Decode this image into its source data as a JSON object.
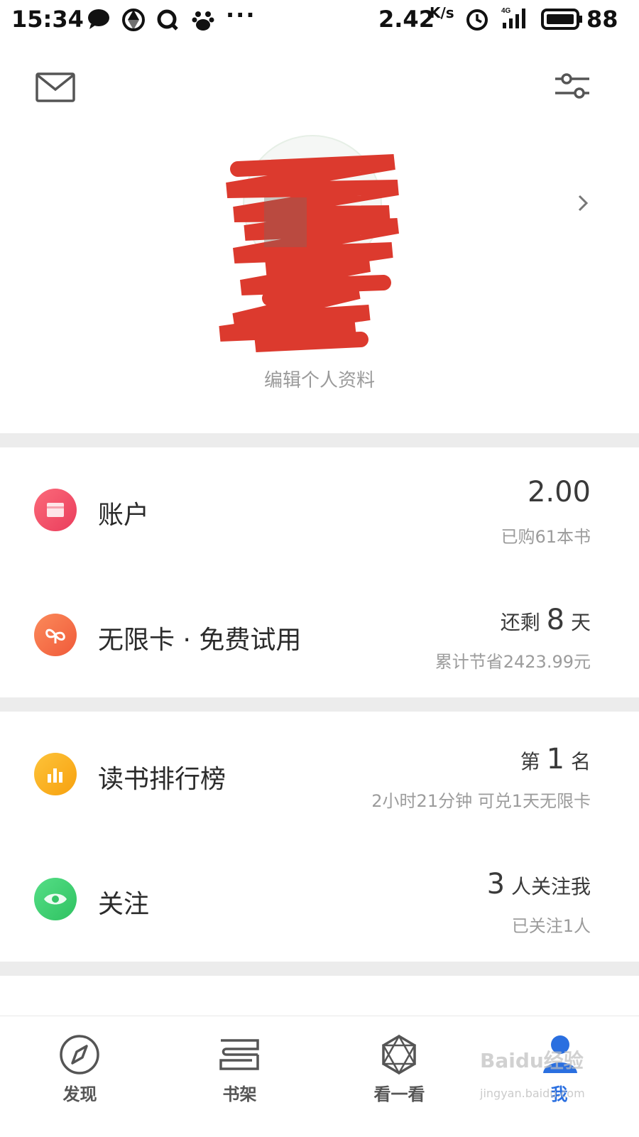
{
  "status_bar": {
    "time": "15:34",
    "more": "···",
    "speed": "2.42",
    "speed_unit": "K/s",
    "network": "4G",
    "battery": "88"
  },
  "header": {
    "left_icon": "mail-icon",
    "right_icon": "settings-sliders-icon"
  },
  "profile": {
    "edit_label": "编辑个人资料"
  },
  "rows": [
    {
      "icon": "wallet-icon",
      "color": "#f15a6e",
      "label": "账户",
      "main_big": "2.00",
      "sub": "已购61本书"
    },
    {
      "icon": "infinity-card-icon",
      "color": "#f5734a",
      "label": "无限卡 · 免费试用",
      "main_pre": "还剩",
      "main_big": "8",
      "main_post": "天",
      "sub": "累计节省2423.99元"
    },
    {
      "icon": "ranking-icon",
      "color": "#fbb21a",
      "label": "读书排行榜",
      "main_pre": "第",
      "main_big": "1",
      "main_post": "名",
      "sub": "2小时21分钟 可兑1天无限卡"
    },
    {
      "icon": "eye-icon",
      "color": "#3fcf72",
      "label": "关注",
      "main_big": "3",
      "main_post": "人关注我",
      "sub": "已关注1人"
    }
  ],
  "bottom_nav": [
    {
      "label": "发现",
      "icon": "compass-icon",
      "active": false
    },
    {
      "label": "书架",
      "icon": "bookshelf-icon",
      "active": false
    },
    {
      "label": "看一看",
      "icon": "star-hexagon-icon",
      "active": false
    },
    {
      "label": "我",
      "icon": "person-icon",
      "active": true
    }
  ],
  "watermark": {
    "main": "Baidu经验",
    "sub": "jingyan.baidu.com"
  }
}
